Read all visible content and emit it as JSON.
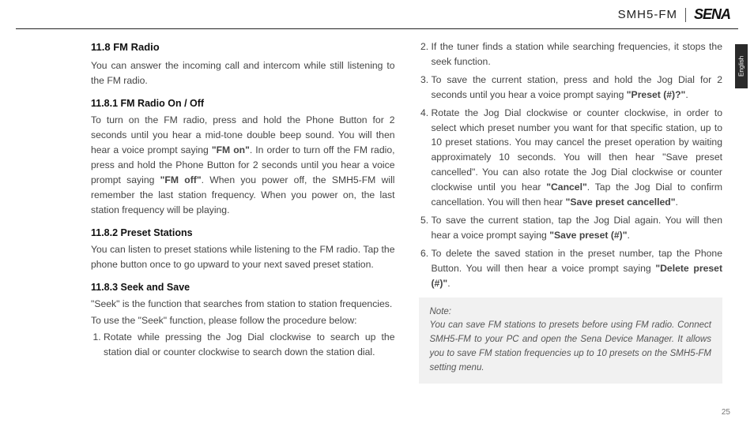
{
  "header": {
    "model": "SMH5-FM",
    "logo": "SENA"
  },
  "lang_tab": "English",
  "section": {
    "heading": "11.8  FM Radio",
    "intro": "You can answer the incoming call and intercom while still listening to the FM radio.",
    "s1": {
      "title": "11.8.1 FM Radio On / Off",
      "body_parts": [
        "To turn on the FM radio, press and hold the Phone Button for 2 seconds until you hear a mid-tone double beep sound. You will then hear a voice prompt saying ",
        "\"FM on\"",
        ". In order to turn off the FM radio, press and hold the Phone Button for 2 seconds until you hear a voice prompt saying ",
        "\"FM off\"",
        ". When you power off, the SMH5-FM will remember the last station frequency. When you power on, the last station frequency will be playing."
      ]
    },
    "s2": {
      "title": "11.8.2 Preset Stations",
      "body": "You can listen to preset stations while listening to the FM radio. Tap the phone button once to go upward to your next saved preset station."
    },
    "s3": {
      "title": "11.8.3 Seek and Save",
      "lead1": "\"Seek\" is the function that searches from station to station frequencies.",
      "lead2": "To use the \"Seek\" function, please follow the procedure below:",
      "steps": [
        {
          "t": "Rotate while pressing the Jog Dial clockwise to search up the station dial or counter clockwise to search down the station dial."
        },
        {
          "t": "If the tuner finds a station while searching frequencies, it stops the seek function."
        },
        {
          "pre": "To save the current station, press and hold the Jog Dial for 2 seconds until you hear a voice prompt saying ",
          "b": "\"Preset (#)?\"",
          "post": "."
        },
        {
          "pre": "Rotate the Jog Dial clockwise or counter clockwise, in order to select which preset number you want for that specific station, up to 10 preset stations. You may cancel the preset operation by waiting approximately 10 seconds. You will then hear \"Save preset cancelled\". You can also rotate the Jog Dial clockwise or counter clockwise until you hear ",
          "b": "\"Cancel\"",
          "mid": ". Tap the Jog Dial to confirm cancellation. You will then hear ",
          "b2": "\"Save preset cancelled\"",
          "post": "."
        },
        {
          "pre": "To save the current station, tap the Jog Dial again.  You will then hear a voice prompt saying ",
          "b": "\"Save preset (#)\"",
          "post": "."
        },
        {
          "pre": "To delete the saved station in the preset number, tap the Phone Button. You will then hear a voice prompt saying ",
          "b": "\"Delete preset (#)\"",
          "post": "."
        }
      ]
    }
  },
  "note": {
    "label": "Note:",
    "body": "You can save FM stations to presets before using FM radio. Connect SMH5-FM to your PC and open the Sena Device Manager. It allows you to save FM station frequencies up to 10 presets on the SMH5-FM setting menu."
  },
  "page_number": "25"
}
